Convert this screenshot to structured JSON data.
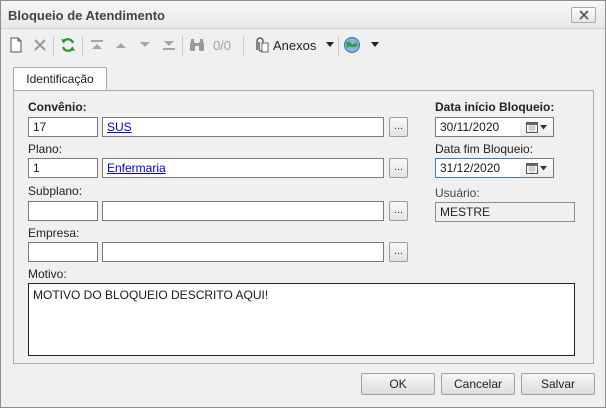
{
  "window": {
    "title": "Bloqueio de Atendimento",
    "close_glyph": "×"
  },
  "toolbar": {
    "counter": "0/0",
    "attachments_label": "Anexos",
    "icons": [
      "new-document-icon",
      "delete-icon",
      "refresh-icon",
      "first-record-icon",
      "previous-record-icon",
      "next-record-icon",
      "last-record-icon",
      "find-icon",
      "paperclip-icon",
      "world-icon"
    ]
  },
  "tabs": [
    {
      "label": "Identificação"
    }
  ],
  "form": {
    "convenio": {
      "label": "Convênio:",
      "code": "17",
      "name": "SUS"
    },
    "plano": {
      "label": "Plano:",
      "code": "1",
      "name": "Enfermaria"
    },
    "subplano": {
      "label": "Subplano:",
      "code": "",
      "name": ""
    },
    "empresa": {
      "label": "Empresa:",
      "code": "",
      "name": ""
    },
    "lookup_button_label": "...",
    "data_inicio": {
      "label": "Data início Bloqueio:",
      "value": "30/11/2020"
    },
    "data_fim": {
      "label": "Data fim Bloqueio:",
      "value": "31/12/2020"
    },
    "usuario": {
      "label": "Usuário:",
      "value": "MESTRE"
    },
    "motivo": {
      "label": "Motivo:",
      "value": "MOTIVO DO BLOQUEIO DESCRITO AQUI!"
    }
  },
  "buttons": {
    "ok": "OK",
    "cancel": "Cancelar",
    "save": "Salvar"
  }
}
